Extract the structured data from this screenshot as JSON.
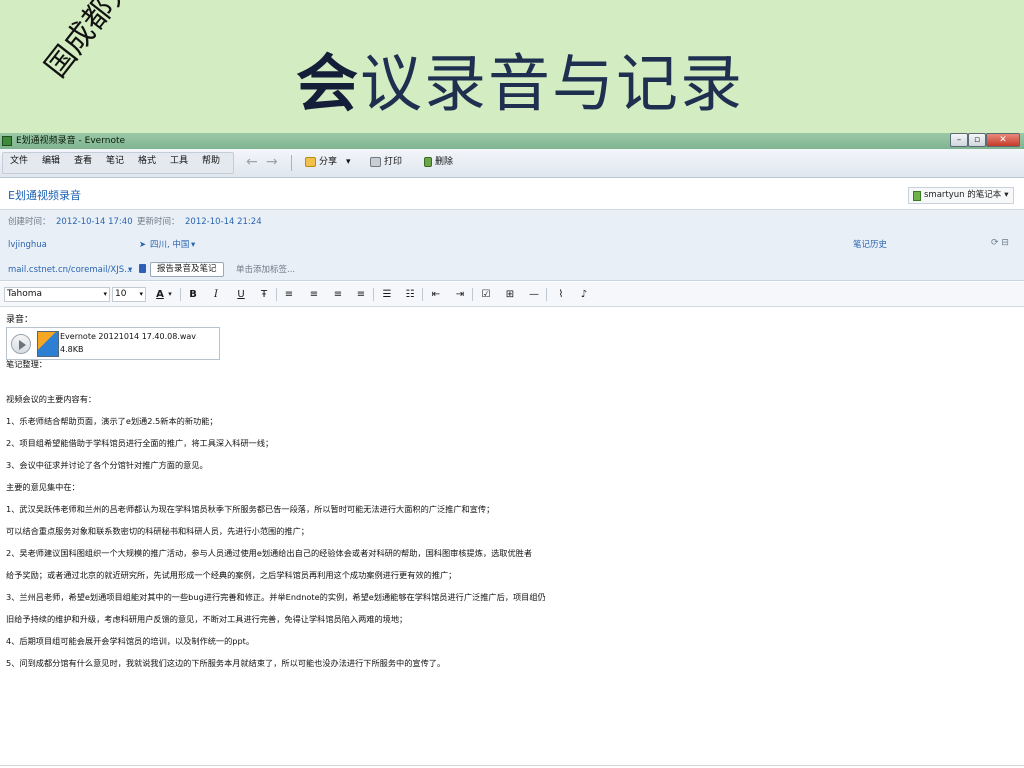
{
  "slide": {
    "title_bold": "会",
    "title_rest": "议录音与记录",
    "watermark": "国成都分馆"
  },
  "window": {
    "title": "E划通视频录音 - Evernote",
    "minimize": "–",
    "maximize": "▫",
    "close": "✕"
  },
  "menu": [
    "文件",
    "编辑",
    "查看",
    "笔记",
    "格式",
    "工具",
    "帮助"
  ],
  "toolbar": {
    "back": "←",
    "forward": "→",
    "share": "分享",
    "share_caret": "▾",
    "print": "打印",
    "delete": "删除"
  },
  "note": {
    "title": "E划通视频录音",
    "notebook": "smartyun 的笔记本",
    "notebook_caret": "▾",
    "created_label": "创建时间：",
    "created_value": "2012-10-14 17:40",
    "updated_label": "更新时间：",
    "updated_value": "2012-10-14 21:24",
    "author": "lvjinghua",
    "location": "四川, 中国",
    "location_caret": "▾",
    "history": "笔记历史",
    "sync_icons": "⟳ ⊟",
    "source_url": "mail.cstnet.cn/coremail/XJS...",
    "source_caret": "▾",
    "tag_button": "报告录音及笔记",
    "tag_placeholder": "单击添加标签..."
  },
  "format_bar": {
    "font": "Tahoma",
    "font_caret": "▾",
    "size": "10",
    "size_caret": "▾",
    "color_a": "A",
    "color_caret": "▾",
    "bold": "B",
    "italic": "I",
    "underline": "U",
    "strike": "Ŧ",
    "align_left": "≡",
    "align_center": "≡",
    "align_right": "≡",
    "justify": "≡",
    "bullets": "☰",
    "numbering": "☷",
    "outdent": "⇤",
    "indent": "⇥",
    "checkbox": "☑",
    "table": "⊞",
    "hr": "—",
    "attach": "⌇",
    "mic": "♪"
  },
  "body": {
    "rec_label": "录音：",
    "attachment_name": "Evernote 20121014 17.40.08.wav",
    "attachment_size": "4.8KB",
    "lines": [
      "笔记整理：",
      "视频会议的主要内容有：",
      "1、乐老师结合帮助页面，演示了e划通2.5新本的新功能；",
      "2、项目组希望能借助于学科馆员进行全面的推广，将工具深入科研一线；",
      "3、会议中征求并讨论了各个分馆针对推广方面的意见。",
      "主要的意见集中在：",
      "1、武汉吴跃伟老师和兰州的吕老师都认为现在学科馆员秋季下所服务都已告一段落，所以暂时可能无法进行大面积的广泛推广和宣传；",
      "可以结合重点服务对象和联系数密切的科研秘书和科研人员，先进行小范围的推广；",
      "2、吴老师建议国科图组织一个大规模的推广活动，参与人员通过使用e划通给出自己的经验体会或者对科研的帮助，国科图审核提炼，选取优胜者",
      "给予奖励；或者通过北京的就近研究所，先试用形成一个经典的案例，之后学科馆员再利用这个成功案例进行更有效的推广；",
      "3、兰州吕老师，希望e划通项目组能对其中的一些bug进行完善和修正。并举Endnote的实例，希望e划通能够在学科馆员进行广泛推广后，项目组仍",
      "旧给予持续的维护和升级，考虑科研用户反馈的意见，不断对工具进行完善，免得让学科馆员陷入两难的境地；",
      "4、后期项目组可能会展开会学科馆员的培训，以及制作统一的ppt。",
      "5、问到成都分馆有什么意见时，我就说我们这边的下所服务本月就结束了，所以可能也没办法进行下所服务中的宣传了。"
    ]
  }
}
